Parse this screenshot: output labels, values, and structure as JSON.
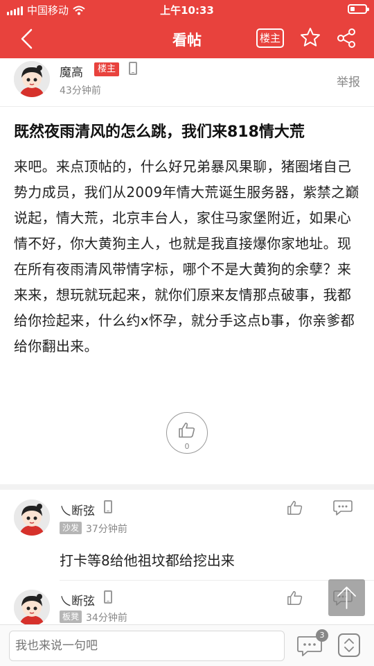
{
  "status_bar": {
    "carrier": "中国移动",
    "time": "上午10:33"
  },
  "nav": {
    "title": "看帖",
    "owner_only_label": "楼主",
    "back_icon": "chevron-left-icon",
    "favorite_icon": "star-icon",
    "share_icon": "share-icon"
  },
  "post": {
    "author": "魔高",
    "owner_badge": "楼主",
    "time": "43分钟前",
    "report_label": "举报",
    "title": "既然夜雨清风的怎么跳，我们来818情大荒",
    "body": "来吧。来点顶帖的，什么好兄弟暴风果聊，猪圈堵自己势力成员，我们从2009年情大荒诞生服务器，紫禁之巅说起，情大荒，北京丰台人，家住马家堡附近，如果心情不好，你大黄狗主人，也就是我直接爆你家地址。现在所有夜雨清风带情字标，哪个不是大黄狗的余孽？来来来，想玩就玩起来，就你们原来友情那点破事，我都给你捡起来，什么约x怀孕，就分手这点b事，你亲爹都给你翻出来。",
    "like_count": "0"
  },
  "comments": [
    {
      "author": "乀断弦",
      "floor": "沙发",
      "time": "37分钟前",
      "text": "打卡等8给他祖坟都给挖出来"
    },
    {
      "author": "乀断弦",
      "floor": "板凳",
      "time": "34分钟前",
      "text": ""
    }
  ],
  "bottom_bar": {
    "input_placeholder": "我也来说一句吧",
    "comment_count": "3"
  },
  "colors": {
    "brand_red": "#e8423d",
    "muted_gray": "#888888"
  }
}
